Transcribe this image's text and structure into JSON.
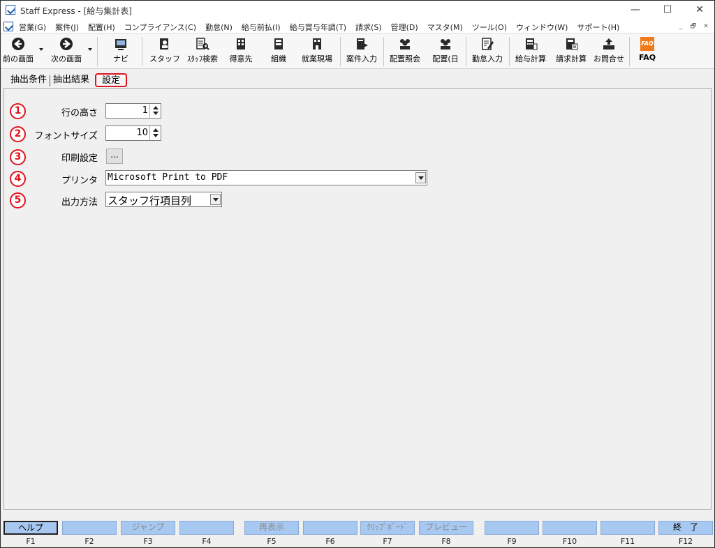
{
  "window": {
    "title": "Staff Express - [給与集計表]",
    "controls": [
      "—",
      "☐",
      "✕"
    ]
  },
  "menu": {
    "items": [
      "営業(G)",
      "案件(J)",
      "配置(H)",
      "コンプライアンス(C)",
      "勤怠(N)",
      "給与前払(I)",
      "給与賞与年調(T)",
      "請求(S)",
      "管理(D)",
      "マスタ(M)",
      "ツール(O)",
      "ウィンドウ(W)",
      "サポート(H)"
    ],
    "mdi": [
      "_",
      "🗗",
      "✕"
    ]
  },
  "toolbar": {
    "back": "前の画面",
    "forward": "次の画面",
    "navi": "ナビ",
    "staff": "スタッフ",
    "staff_search": "ｽﾀｯﾌ検索",
    "client": "得意先",
    "org": "組織",
    "worksite": "就業現場",
    "case_entry": "案件入力",
    "assign_query": "配置照会",
    "assign_day": "配置(日",
    "attendance": "勤怠入力",
    "payroll": "給与計算",
    "billing": "請求計算",
    "contact": "お問合せ",
    "faq": "FAQ",
    "faq_icon_text": "FAQ"
  },
  "tabs": {
    "conditions": "抽出条件",
    "results": "抽出結果",
    "settings": "設定"
  },
  "form": {
    "row_height": {
      "badge": "1",
      "label": "行の高さ",
      "value": "1"
    },
    "font_size": {
      "badge": "2",
      "label": "フォントサイズ",
      "value": "10"
    },
    "print_settings": {
      "badge": "3",
      "label": "印刷設定",
      "button": "..."
    },
    "printer": {
      "badge": "4",
      "label": "プリンタ",
      "value": "Microsoft Print to PDF"
    },
    "output_method": {
      "badge": "5",
      "label": "出力方法",
      "value": "スタッフ行項目列"
    }
  },
  "fkeys": [
    {
      "label": "ヘルプ",
      "key": "F1"
    },
    {
      "label": "",
      "key": "F2"
    },
    {
      "label": "ジャンプ",
      "key": "F3"
    },
    {
      "label": "",
      "key": "F4"
    },
    {
      "label": "再表示",
      "key": "F5"
    },
    {
      "label": "",
      "key": "F6"
    },
    {
      "label": "ｸﾘｯﾌﾟﾎﾞｰﾄﾞ",
      "key": "F7"
    },
    {
      "label": "プレビュー",
      "key": "F8"
    },
    {
      "label": "",
      "key": "F9"
    },
    {
      "label": "",
      "key": "F10"
    },
    {
      "label": "",
      "key": "F11"
    },
    {
      "label": "終　了",
      "key": "F12"
    }
  ],
  "colors": {
    "accent_red": "#e0141e",
    "fkey_blue": "#a7c8f0",
    "icon_blue": "#1f5fa8"
  }
}
